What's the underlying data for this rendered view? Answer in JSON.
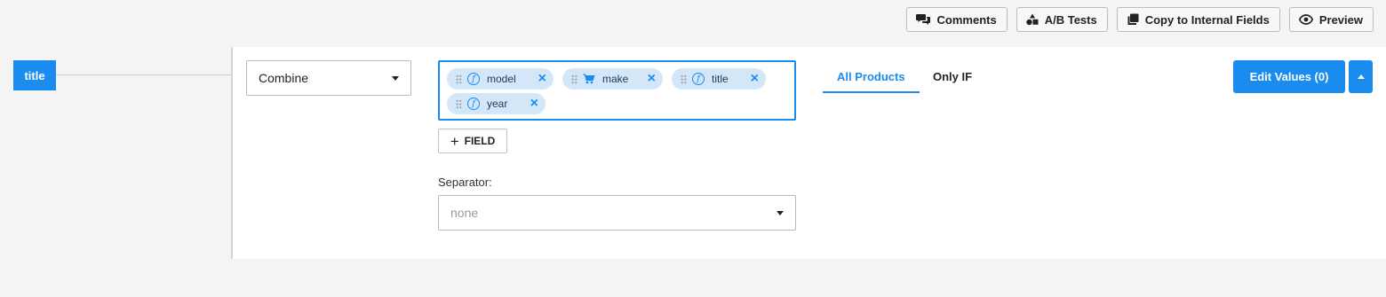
{
  "toolbar": {
    "comments_label": "Comments",
    "ab_tests_label": "A/B Tests",
    "copy_label": "Copy to Internal Fields",
    "preview_label": "Preview"
  },
  "field": {
    "name": "title"
  },
  "combine": {
    "selected": "Combine"
  },
  "tags": [
    {
      "label": "model",
      "icon": "function-icon"
    },
    {
      "label": "make",
      "icon": "cart-icon"
    },
    {
      "label": "title",
      "icon": "function-icon"
    },
    {
      "label": "year",
      "icon": "function-icon"
    }
  ],
  "add_field": {
    "label": "FIELD"
  },
  "separator": {
    "label": "Separator:",
    "value": "none"
  },
  "tabs": {
    "all_products": "All Products",
    "only_if": "Only IF"
  },
  "edit_values": {
    "label": "Edit Values (0)"
  },
  "colors": {
    "accent": "#1a8cf0",
    "chip_bg": "#d4e7f8",
    "panel_bg": "#ffffff",
    "page_bg": "#f4f4f4"
  }
}
